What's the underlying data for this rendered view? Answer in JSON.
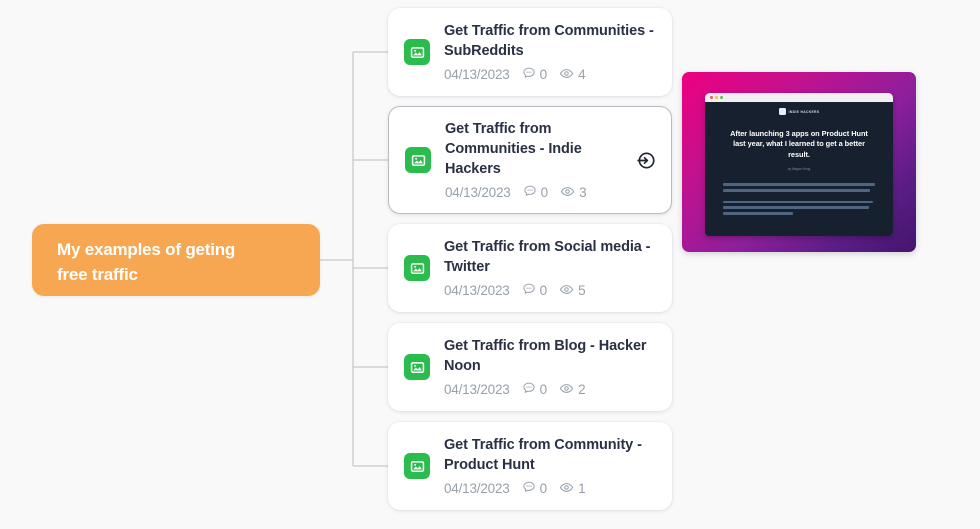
{
  "canvas": {
    "background_color": "#f9f9fa",
    "connector_color": "#c7c9cc"
  },
  "root_node": {
    "label": "My examples of geting\nfree traffic",
    "background_color": "#f7a651",
    "text_color": "#ffffff"
  },
  "cards": [
    {
      "icon_name": "image-icon",
      "icon_color": "#2bbc4e",
      "title": "Get Traffic from Communities - SubReddits",
      "date": "04/13/2023",
      "comments": "0",
      "views": "4",
      "selected": false,
      "has_action": false
    },
    {
      "icon_name": "image-icon",
      "icon_color": "#2bbc4e",
      "title": "Get Traffic from Communities - Indie Hackers",
      "date": "04/13/2023",
      "comments": "0",
      "views": "3",
      "selected": true,
      "has_action": true,
      "action_icon_name": "enter-arrow-icon"
    },
    {
      "icon_name": "image-icon",
      "icon_color": "#2bbc4e",
      "title": "Get Traffic from Social media - Twitter",
      "date": "04/13/2023",
      "comments": "0",
      "views": "5",
      "selected": false,
      "has_action": false
    },
    {
      "icon_name": "image-icon",
      "icon_color": "#2bbc4e",
      "title": "Get Traffic from Blog - Hacker Noon",
      "date": "04/13/2023",
      "comments": "0",
      "views": "2",
      "selected": false,
      "has_action": false
    },
    {
      "icon_name": "image-icon",
      "icon_color": "#2bbc4e",
      "title": "Get Traffic from Community - Product Hunt",
      "date": "04/13/2023",
      "comments": "0",
      "views": "1",
      "selected": false,
      "has_action": false
    }
  ],
  "preview": {
    "gradient_from": "#ee0080",
    "gradient_to": "#43156e",
    "page_background": "#16202f",
    "brand_text": "INDIE HACKERS",
    "headline": "After launching 3 apps on Product Hunt last year, what I learned to get a better result.",
    "byline": "by Megan Hong"
  }
}
